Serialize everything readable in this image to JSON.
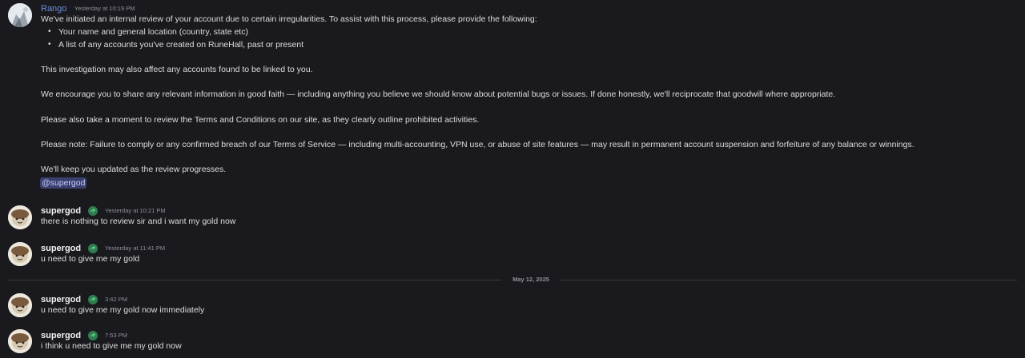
{
  "messages": [
    {
      "author": "Rango",
      "timestamp": "Yesterday at 10:19 PM",
      "intro": "We've initiated an internal review of your account due to certain irregularities. To assist with this process, please provide the following:",
      "bullets": [
        "Your name and general location (country, state etc)",
        "A list of any accounts you've created on RuneHall, past or present"
      ],
      "paragraphs": [
        "This investigation may also affect any accounts found to be linked to you.",
        "We encourage you to share any relevant information in good faith — including anything you believe we should know about potential bugs or issues. If done honestly, we'll reciprocate that goodwill where appropriate.",
        "Please also take a moment to review the Terms and Conditions on our site, as they clearly outline prohibited activities.",
        "Please note: Failure to comply or any confirmed breach of our Terms of Service — including multi-accounting, VPN use, or abuse of site features — may result in permanent account suspension and forfeiture of any balance or winnings.",
        "We'll keep you updated as the review progresses."
      ],
      "mention": "@supergod"
    },
    {
      "author": "supergod",
      "timestamp": "Yesterday at 10:21 PM",
      "text": "there is nothing to review sir and i want my gold now"
    },
    {
      "author": "supergod",
      "timestamp": "Yesterday at 11:41 PM",
      "text": "u need to give me my gold"
    },
    {
      "author": "supergod",
      "timestamp": "3:42 PM",
      "text": "u need to give me my gold now immediately"
    },
    {
      "author": "supergod",
      "timestamp": "7:53 PM",
      "text": "i think u need to give me my gold now"
    }
  ],
  "date_divider": "May 12, 2025",
  "colors": {
    "background": "#1a1a1e",
    "rango_name": "#6b8fd6",
    "mention_bg": "#3b3f6e",
    "badge_green": "#43b581"
  },
  "icons": {
    "badge": "leaf-badge-icon",
    "bullet": "•"
  }
}
